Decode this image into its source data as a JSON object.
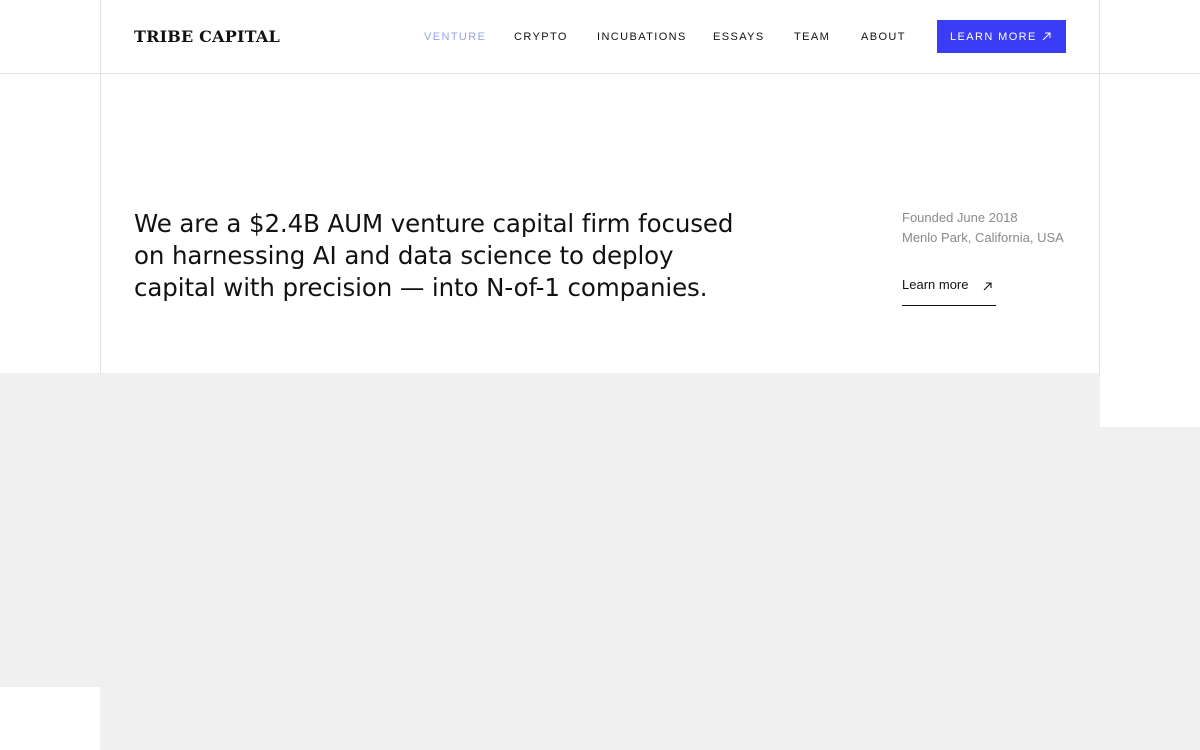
{
  "brand": {
    "logo_text": "TRIBE CAPITAL"
  },
  "nav": {
    "items": [
      {
        "label": "VENTURE",
        "active": true
      },
      {
        "label": "CRYPTO"
      },
      {
        "label": "INCUBATIONS"
      },
      {
        "label": "ESSAYS"
      },
      {
        "label": "TEAM"
      },
      {
        "label": "ABOUT"
      }
    ],
    "cta_label": "LEARN MORE",
    "cta_icon": "arrow-up-right-icon"
  },
  "hero": {
    "headline": "We are a $2.4B AUM venture capital firm focused on harnessing AI and data science to deploy capital with precision — into N-of-1 companies.",
    "founded": "Founded June 2018",
    "location": "Menlo Park, California, USA",
    "link_label": "Learn more",
    "link_icon": "arrow-up-right-icon"
  },
  "colors": {
    "accent": "#3a3df5",
    "active_nav": "#9aa3e6",
    "muted_text": "#8a8a8a",
    "gray_panel": "#f0f0f0",
    "rule": "#e2e2e2"
  }
}
